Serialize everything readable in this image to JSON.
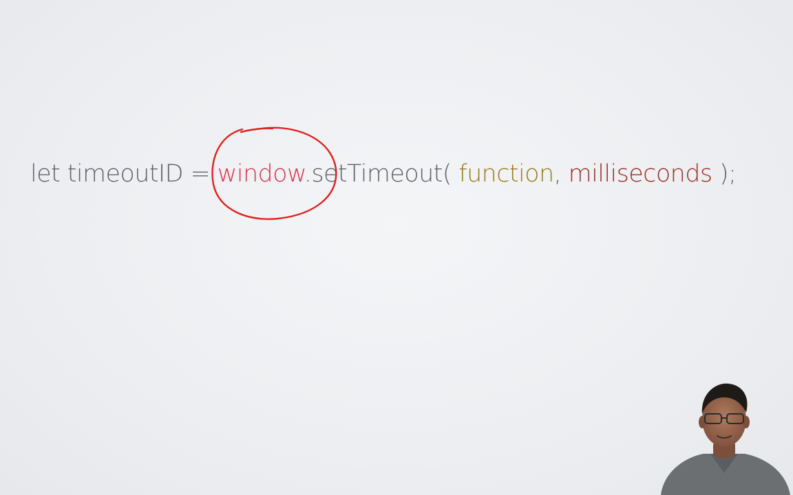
{
  "code": {
    "kw_let": "let",
    "var_name": "timeoutID",
    "equals": "=",
    "obj_window": "window",
    "dot": ".",
    "method": "setTimeout(",
    "arg_function": "function",
    "comma": ",",
    "arg_ms": "milliseconds",
    "close": ");"
  },
  "colors": {
    "code_default": "#5f636a",
    "window_token": "#d8344d",
    "function_token": "#9c7a1c",
    "milliseconds_token": "#9b2f24",
    "annotation_ink": "#e0201f"
  },
  "presenter": {
    "icon": "presenter-webcam-thumbnail"
  }
}
